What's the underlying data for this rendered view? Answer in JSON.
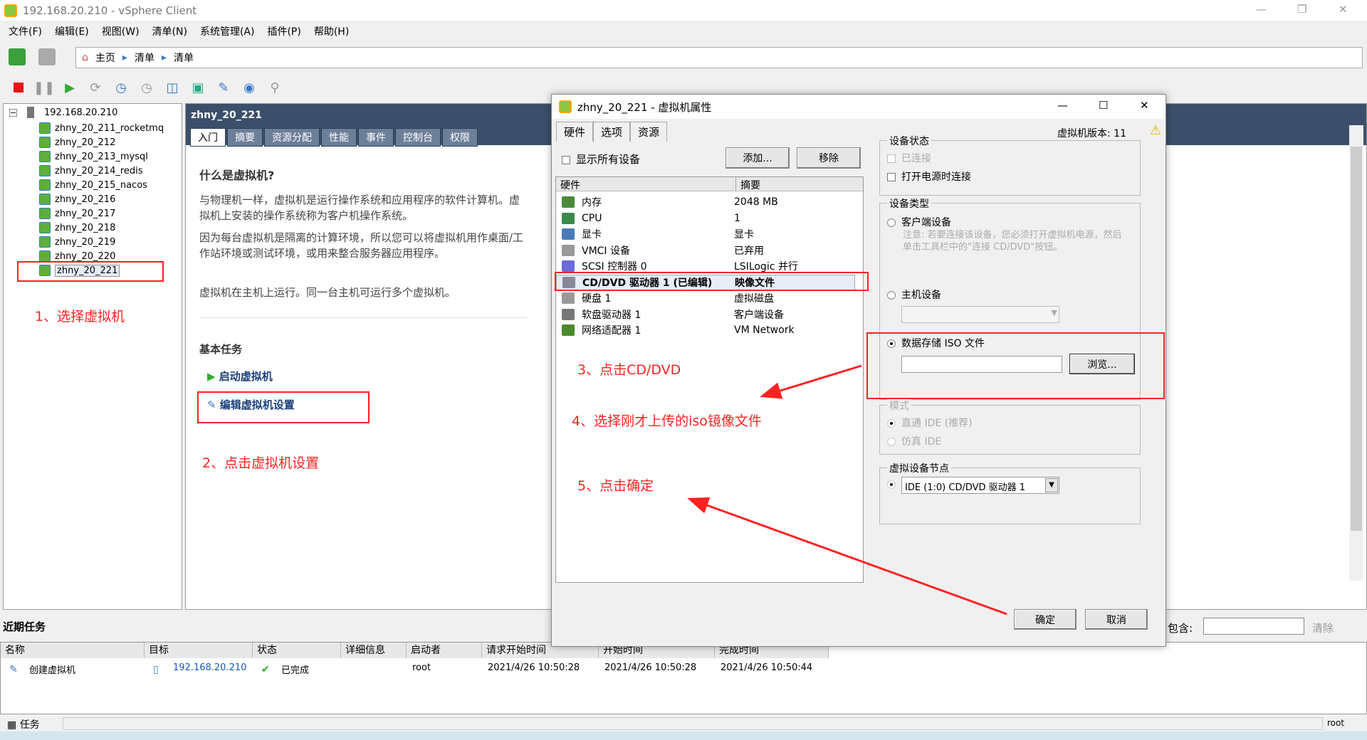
{
  "window": {
    "title": "192.168.20.210 - vSphere Client"
  },
  "menu": [
    "文件(F)",
    "编辑(E)",
    "视图(W)",
    "清单(N)",
    "系统管理(A)",
    "插件(P)",
    "帮助(H)"
  ],
  "breadcrumb": [
    "主页",
    "清单",
    "清单"
  ],
  "tree": {
    "host": "192.168.20.210",
    "vms": [
      "zhny_20_211_rocketmq",
      "zhny_20_212",
      "zhny_20_213_mysql",
      "zhny_20_214_redis",
      "zhny_20_215_nacos",
      "zhny_20_216",
      "zhny_20_217",
      "zhny_20_218",
      "zhny_20_219",
      "zhny_20_220",
      "zhny_20_221"
    ]
  },
  "main": {
    "title": "zhny_20_221",
    "tabs": [
      "入门",
      "摘要",
      "资源分配",
      "性能",
      "事件",
      "控制台",
      "权限"
    ],
    "heading": "什么是虚拟机?",
    "p1": "与物理机一样，虚拟机是运行操作系统和应用程序的软件计算机。虚拟机上安装的操作系统称为客户机操作系统。",
    "p2": "因为每台虚拟机是隔离的计算环境，所以您可以将虚拟机用作桌面/工作站环境或测试环境，或用来整合服务器应用程序。",
    "p3": "虚拟机在主机上运行。同一台主机可运行多个虚拟机。",
    "basic_tasks": "基本任务",
    "task_start": "启动虚拟机",
    "task_edit": "编辑虚拟机设置"
  },
  "dialog": {
    "title": "zhny_20_221 - 虚拟机属性",
    "tabs": [
      "硬件",
      "选项",
      "资源"
    ],
    "version": "虚拟机版本: 11",
    "show_all": "显示所有设备",
    "add": "添加...",
    "remove": "移除",
    "col_hw": "硬件",
    "col_summary": "摘要",
    "hardware": [
      {
        "name": "内存",
        "summary": "2048 MB"
      },
      {
        "name": "CPU",
        "summary": "1"
      },
      {
        "name": "显卡",
        "summary": "显卡"
      },
      {
        "name": "VMCI 设备",
        "summary": "已弃用"
      },
      {
        "name": "SCSI 控制器 0",
        "summary": "LSILogic 并行"
      },
      {
        "name": "CD/DVD 驱动器 1 (已编辑)",
        "summary": "映像文件"
      },
      {
        "name": "硬盘 1",
        "summary": "虚拟磁盘"
      },
      {
        "name": "软盘驱动器 1",
        "summary": "客户端设备"
      },
      {
        "name": "网络适配器 1",
        "summary": "VM Network"
      }
    ],
    "device_status": "设备状态",
    "connected": "已连接",
    "connect_power_on": "打开电源时连接",
    "device_type": "设备类型",
    "client_device": "客户端设备",
    "note": "注意: 若要连接该设备，您必须打开虚拟机电源，然后单击工具栏中的\"连接 CD/DVD\"按钮。",
    "host_device": "主机设备",
    "datastore_iso": "数据存储 ISO 文件",
    "iso_value": "",
    "browse": "浏览...",
    "mode": "模式",
    "passthrough": "直通 IDE (推荐)",
    "emulate": "仿真 IDE",
    "node": "虚拟设备节点",
    "node_value": "IDE (1:0) CD/DVD 驱动器 1",
    "ok": "确定",
    "cancel": "取消"
  },
  "annotations": [
    "1、选择虚拟机",
    "2、点击虚拟机设置",
    "3、点击CD/DVD",
    "4、选择刚才上传的iso镜像文件",
    "5、点击确定"
  ],
  "tasks": {
    "title": "近期任务",
    "filter_label": "包含:",
    "clear": "清除",
    "columns": [
      "名称",
      "目标",
      "状态",
      "详细信息",
      "启动者",
      "请求开始时间",
      "开始时间",
      "完成时间"
    ],
    "rows": [
      {
        "name": "创建虚拟机",
        "target": "192.168.20.210",
        "status": "已完成",
        "details": "",
        "initiator": "root",
        "requested": "2021/4/26 10:50:28",
        "start": "2021/4/26 10:50:28",
        "end": "2021/4/26 10:50:44"
      }
    ]
  },
  "status": {
    "tasks": "任务",
    "user": "root"
  },
  "colors": {
    "annotation": "#ff2222",
    "header": "#3b4f6b",
    "link": "#1a56b8"
  }
}
